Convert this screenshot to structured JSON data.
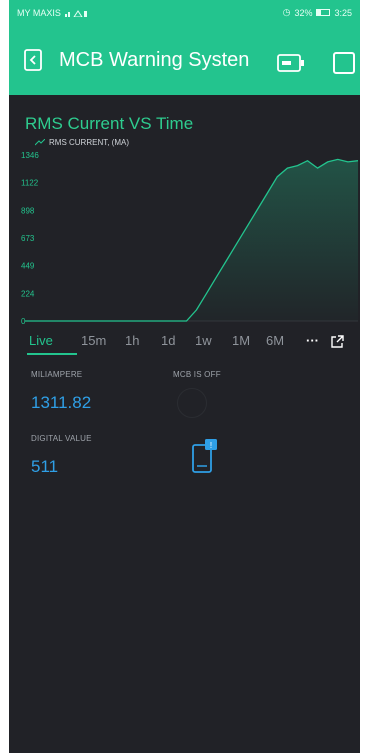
{
  "status_bar": {
    "carrier": "MY MAXIS",
    "battery": "32%",
    "time": "3:25"
  },
  "header": {
    "title": "MCB Warning Systen"
  },
  "chart_data": {
    "type": "area",
    "title": "RMS Current VS Time",
    "series": [
      {
        "name": "RMS CURRENT, (MA)",
        "values": [
          0,
          0,
          0,
          0,
          0,
          0,
          0,
          0,
          0,
          0,
          0,
          0,
          0,
          0,
          0,
          0,
          0,
          90,
          225,
          360,
          495,
          630,
          765,
          900,
          1035,
          1170,
          1240,
          1260,
          1300,
          1240,
          1290,
          1310,
          1290,
          1300
        ]
      }
    ],
    "y_ticks": [
      "1346",
      "1122",
      "898",
      "673",
      "449",
      "224",
      "0"
    ],
    "ylim": [
      0,
      1346
    ],
    "color": "#23c48e",
    "grid": false
  },
  "time_ranges": [
    "Live",
    "15m",
    "1h",
    "1d",
    "1w",
    "1M",
    "6M"
  ],
  "time_range_selected": "Live",
  "widgets": {
    "current": {
      "label": "MILIAMPERE",
      "value": "1311.82"
    },
    "mcb": {
      "label": "MCB IS OFF"
    },
    "digital": {
      "label": "DIGITAL VALUE",
      "value": "511"
    },
    "notification_badge": "!"
  },
  "colors": {
    "accent": "#23c48e",
    "value": "#2f9fe6",
    "background": "#212227"
  }
}
